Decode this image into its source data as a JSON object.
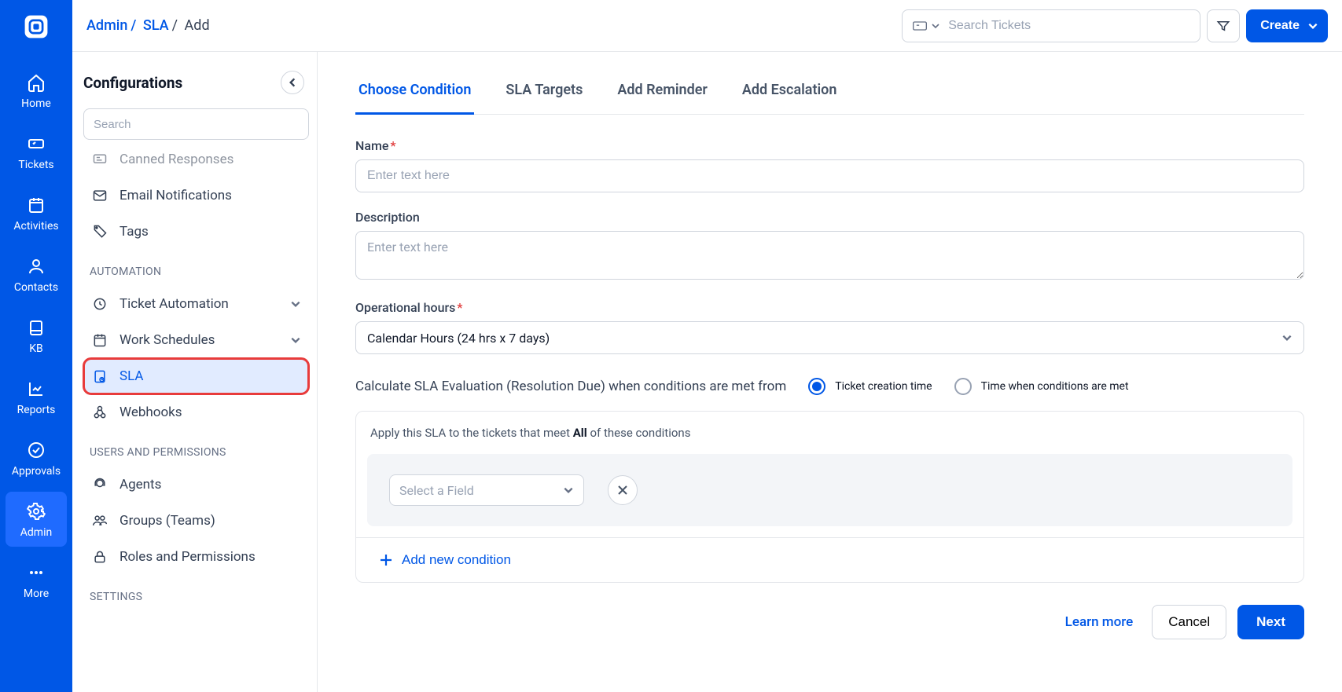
{
  "header": {
    "breadcrumb": {
      "admin": "Admin",
      "sla": "SLA",
      "add": "Add"
    },
    "search_placeholder": "Search Tickets",
    "create_label": "Create"
  },
  "leftnav": {
    "items": [
      {
        "label": "Home"
      },
      {
        "label": "Tickets"
      },
      {
        "label": "Activities"
      },
      {
        "label": "Contacts"
      },
      {
        "label": "KB"
      },
      {
        "label": "Reports"
      },
      {
        "label": "Approvals"
      },
      {
        "label": "Admin"
      },
      {
        "label": "More"
      }
    ]
  },
  "configcol": {
    "title": "Configurations",
    "search_placeholder": "Search",
    "top_partial": "Canned Responses",
    "items_top": [
      "Email Notifications",
      "Tags"
    ],
    "group_automation": "AUTOMATION",
    "items_automation": [
      "Ticket Automation",
      "Work Schedules",
      "SLA",
      "Webhooks"
    ],
    "group_users": "USERS AND PERMISSIONS",
    "items_users": [
      "Agents",
      "Groups (Teams)",
      "Roles and Permissions"
    ],
    "group_settings": "SETTINGS"
  },
  "tabs": [
    "Choose Condition",
    "SLA Targets",
    "Add Reminder",
    "Add Escalation"
  ],
  "form": {
    "name_label": "Name",
    "name_placeholder": "Enter text here",
    "desc_label": "Description",
    "desc_placeholder": "Enter text here",
    "hours_label": "Operational hours",
    "hours_value": "Calendar Hours (24 hrs x 7 days)",
    "calc_label": "Calculate SLA Evaluation (Resolution Due) when conditions are met from",
    "radio1": "Ticket creation time",
    "radio2": "Time when conditions are met",
    "cond_prefix": "Apply this SLA to the tickets that meet ",
    "cond_bold": "All",
    "cond_suffix": " of these conditions",
    "select_placeholder": "Select a Field",
    "add_new": "Add new condition"
  },
  "footer": {
    "learn": "Learn more",
    "cancel": "Cancel",
    "next": "Next"
  }
}
